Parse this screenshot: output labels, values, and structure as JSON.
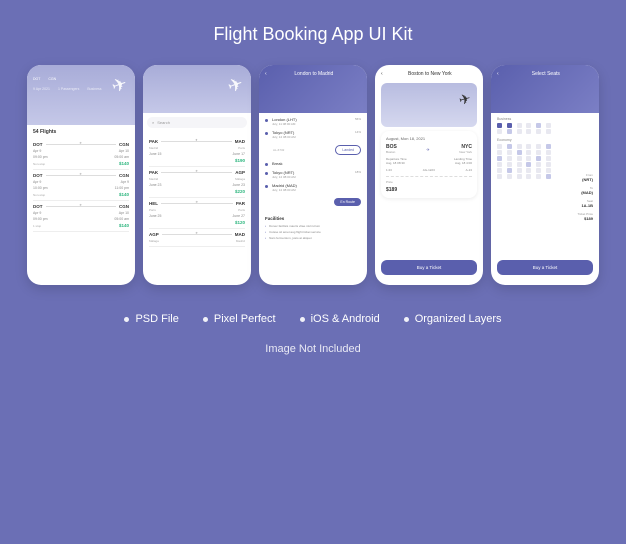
{
  "title": "Flight Booking App UI Kit",
  "features": [
    "PSD File",
    "Pixel Perfect",
    "iOS & Android",
    "Organized Layers"
  ],
  "footer_note": "Image Not Included",
  "screen1": {
    "header_tabs": [
      "DOT",
      "CGN"
    ],
    "header_date": "9 Apr 2021",
    "header_passengers": "1 Passengers",
    "header_class": "Business",
    "flights_count": "54 Flights",
    "flights": [
      {
        "from": "DOT",
        "to": "CGN",
        "date1": "Apr 9",
        "date2": "Apr 10",
        "time1": "09:00 pm",
        "time2": "05:00 am",
        "stop": "Non-stop",
        "price": "$140"
      },
      {
        "from": "DOT",
        "to": "CGN",
        "date1": "Apr 9",
        "date2": "Apr 9",
        "time1": "10:00 pm",
        "time2": "11:00 pm",
        "stop": "Non-stop",
        "price": "$140"
      },
      {
        "from": "DOT",
        "to": "CGN",
        "date1": "Apr 9",
        "date2": "Apr 10",
        "time1": "09:00 pm",
        "time2": "05:00 am",
        "stop": "1 stop",
        "price": "$140"
      }
    ]
  },
  "screen2": {
    "search_placeholder": "Search",
    "flights": [
      {
        "from": "PAK",
        "from_city": "Madrid",
        "to": "MAD",
        "to_city": "Paris",
        "date1": "June 15",
        "date2": "June 17",
        "price": "$190"
      },
      {
        "from": "PAK",
        "from_city": "Madrid",
        "to": "AGP",
        "to_city": "Málaga",
        "date1": "June 23",
        "date2": "June 23",
        "price": "$220"
      },
      {
        "from": "HEL",
        "from_city": "Paris",
        "to": "PAR",
        "to_city": "Paris",
        "date1": "June 25",
        "date2": "June 27",
        "price": "$120"
      },
      {
        "from": "AGP",
        "from_city": "Málaga",
        "to": "MAD",
        "to_city": "Madrid",
        "date1": "",
        "date2": "",
        "price": ""
      }
    ]
  },
  "screen3": {
    "title": "London to Madrid",
    "timeline": [
      {
        "label": "London (LHT)",
        "sub": "July, 11 08:00 AM",
        "hum": "56%"
      },
      {
        "label": "Tokyo (NRT)",
        "sub": "July, 12 08:00 AM",
        "hum": "14%"
      }
    ],
    "flight_id": "AL-6732",
    "status1": "Landed",
    "break_label": "Break",
    "timeline2": [
      {
        "label": "Tokyo (NRT)",
        "sub": "July, 12 08:00 AM",
        "hum": "18%"
      },
      {
        "label": "Madrid (MAD)",
        "sub": "July, 12 08:00 AM",
        "hum": ""
      }
    ],
    "status2": "En Route",
    "facilities_title": "Facilities",
    "facilities": [
      "Donec facilisis mauris vitae nisl rutrum",
      "Cuisse sit amet aug flight ticket service",
      "Nam fermentum, justo at aliquet"
    ]
  },
  "screen4": {
    "title": "Boston to New York",
    "date": "August, Mon 18, 2021",
    "from_code": "BOS",
    "from_city": "Boston",
    "to_code": "NYC",
    "to_city": "New York",
    "dep_label": "Departure Time",
    "land_label": "Landing Time",
    "dep_time": "Aug, 18 08:30",
    "land_time": "Aug, 18 4:00",
    "passengers": "1:23",
    "flight_no": "AG-1223",
    "seat": "A-13",
    "price_label": "Price",
    "price": "$189",
    "button": "Buy a Ticket"
  },
  "screen5": {
    "title": "Select Seats",
    "section1": "Business",
    "section2": "Economy",
    "from_label": "From",
    "from_val": "(NRT)",
    "to_label": "To",
    "to_val": "(MAD)",
    "seat_label": "Seat",
    "seat_val": "1A-1B",
    "price_label": "Ticket Price",
    "price_val": "$189",
    "button": "Buy a Ticket"
  }
}
